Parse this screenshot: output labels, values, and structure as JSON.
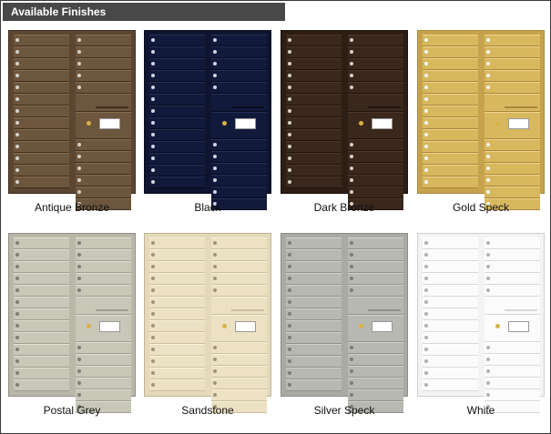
{
  "header": {
    "title": "Available Finishes"
  },
  "finishes": [
    {
      "name": "Antique Bronze",
      "body": "#5b4631",
      "door": "#6c563d",
      "hi": "#876d52",
      "lo": "#3e2f1f",
      "lock": "#d7d2c8",
      "edge": "#3d2e1f"
    },
    {
      "name": "Black",
      "body": "#0f1430",
      "door": "#121a3b",
      "hi": "#253056",
      "lo": "#080b1d",
      "lock": "#cfd6e6",
      "edge": "#0a0e22"
    },
    {
      "name": "Dark Bronze",
      "body": "#2c1d15",
      "door": "#3a281c",
      "hi": "#4c3628",
      "lo": "#1f140f",
      "lock": "#d8d1c8",
      "edge": "#1d130d"
    },
    {
      "name": "Gold Speck",
      "body": "#c5a24b",
      "door": "#d7b85f",
      "hi": "#f1d48d",
      "lo": "#a9863b",
      "lock": "#f7f5ef",
      "edge": "#a98b3e"
    },
    {
      "name": "Postal Grey",
      "body": "#b8b7a8",
      "door": "#c8c7b8",
      "hi": "#e1e0d3",
      "lo": "#9e9d90",
      "lock": "#7e7e77",
      "edge": "#8f8f86"
    },
    {
      "name": "Sandstone",
      "body": "#e4d9b8",
      "door": "#ece2c3",
      "hi": "#f8f1dd",
      "lo": "#cbbf9b",
      "lock": "#9f937a",
      "edge": "#bfb391"
    },
    {
      "name": "Silver Speck",
      "body": "#a8aaa3",
      "door": "#b7b8b2",
      "hi": "#d1d2cd",
      "lo": "#8f918b",
      "lock": "#7a7c77",
      "edge": "#8b8d88"
    },
    {
      "name": "White",
      "body": "#f3f3f3",
      "door": "#fbfbfb",
      "hi": "#ffffff",
      "lo": "#d8d8d8",
      "lock": "#b1b1b1",
      "edge": "#cfcfcf"
    }
  ]
}
